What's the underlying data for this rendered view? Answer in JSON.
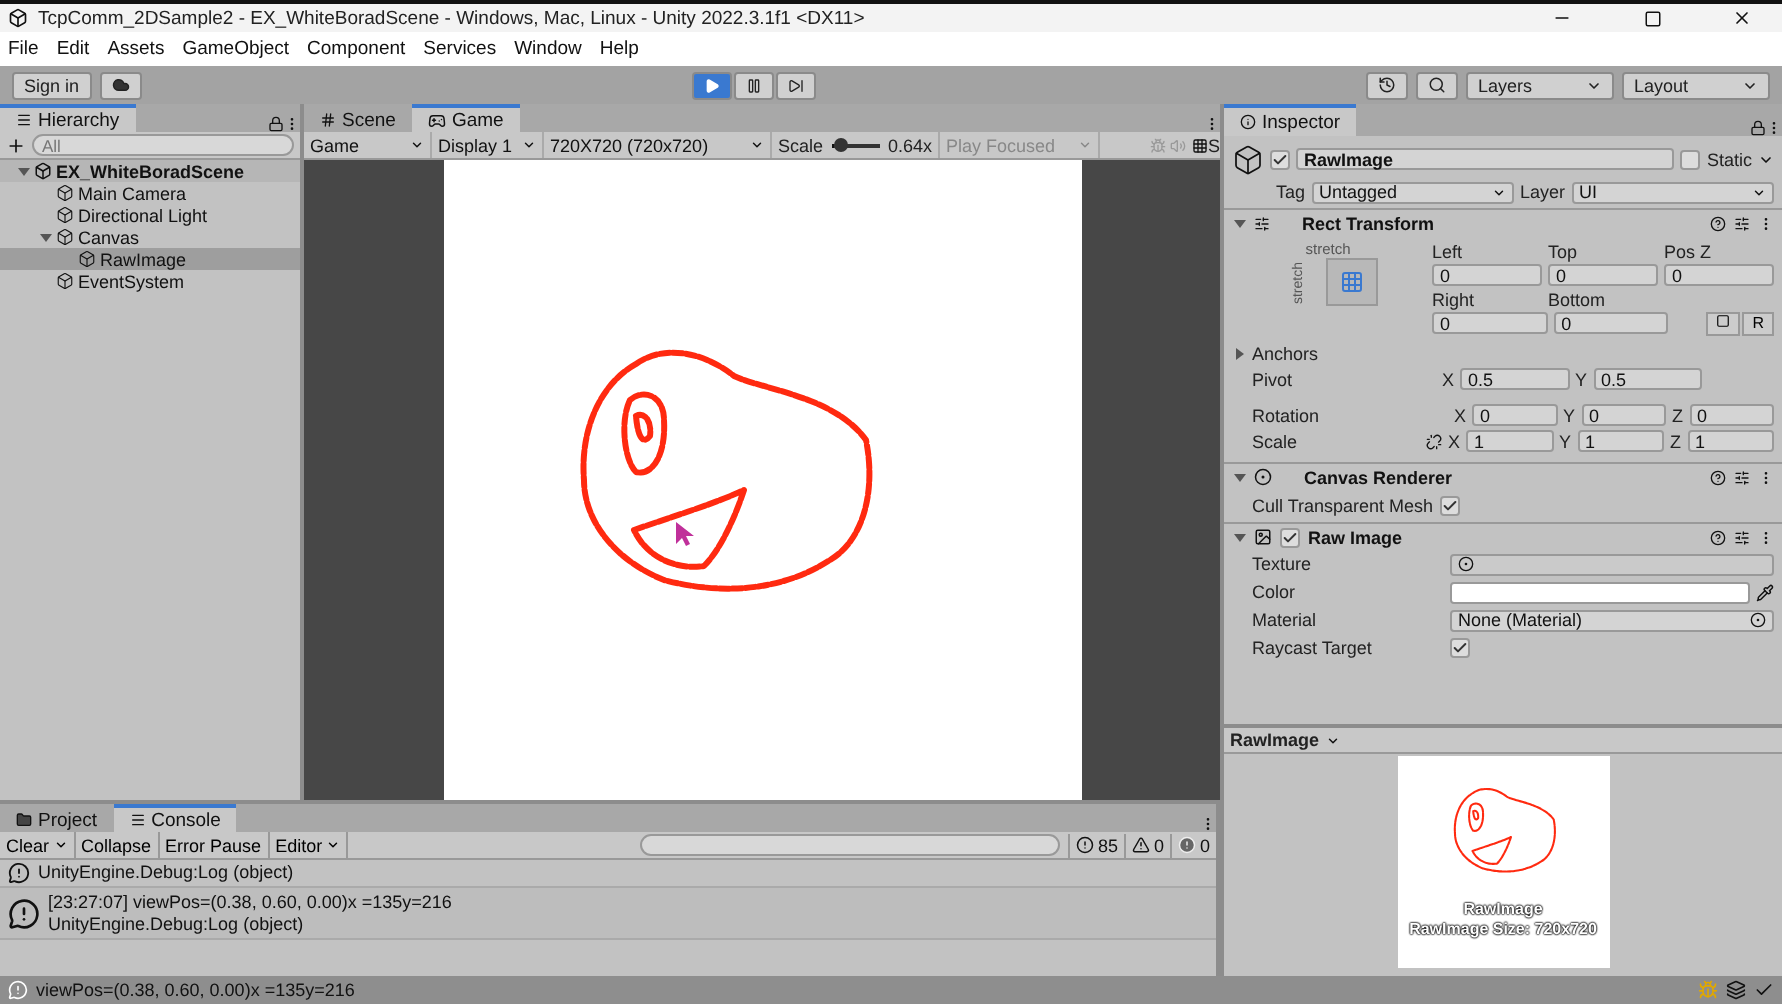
{
  "window": {
    "title": "TcpComm_2DSample2 - EX_WhiteBoradScene - Windows, Mac, Linux - Unity 2022.3.1f1 <DX11>"
  },
  "menu": [
    "File",
    "Edit",
    "Assets",
    "GameObject",
    "Component",
    "Services",
    "Window",
    "Help"
  ],
  "toolbar": {
    "sign_in": "Sign in",
    "playing": true,
    "layers": "Layers",
    "layout": "Layout"
  },
  "hierarchy": {
    "title": "Hierarchy",
    "search": {
      "placeholder": "All"
    },
    "items": [
      {
        "label": "EX_WhiteBoradScene",
        "kind": "scene",
        "expanded": true,
        "selected": false,
        "children": [
          {
            "label": "Main Camera",
            "kind": "object",
            "selected": false
          },
          {
            "label": "Directional Light",
            "kind": "object",
            "selected": false
          },
          {
            "label": "Canvas",
            "kind": "object",
            "expanded": true,
            "selected": false,
            "children": [
              {
                "label": "RawImage",
                "kind": "object",
                "selected": true
              }
            ]
          },
          {
            "label": "EventSystem",
            "kind": "object",
            "selected": false
          }
        ]
      }
    ]
  },
  "game": {
    "tabs": [
      {
        "label": "Scene",
        "selected": false
      },
      {
        "label": "Game",
        "selected": true
      }
    ],
    "view_dropdown": "Game",
    "display": "Display 1",
    "resolution": "720X720 (720x720)",
    "scale_label": "Scale",
    "scale": {
      "level": 0.05
    },
    "scale_value": "0.64x",
    "play_mode": "Play Focused",
    "stats": "S"
  },
  "inspector": {
    "title": "Inspector",
    "object": {
      "name": "RawImage",
      "active": true,
      "static_label": "Static",
      "static": false,
      "tag_label": "Tag",
      "tag": "Untagged",
      "layer_label": "Layer",
      "layer": "UI"
    },
    "rect_transform": {
      "title": "Rect Transform",
      "preset_top": "stretch",
      "preset_side": "stretch",
      "fields_row1": [
        {
          "label": "Left",
          "value": "0"
        },
        {
          "label": "Top",
          "value": "0"
        },
        {
          "label": "Pos Z",
          "value": "0"
        }
      ],
      "fields_row2": [
        {
          "label": "Right",
          "value": "0"
        },
        {
          "label": "Bottom",
          "value": "0"
        }
      ],
      "raw_button": "R",
      "anchors": "Anchors",
      "pivot": {
        "label": "Pivot",
        "axes": [
          {
            "axis": "X",
            "value": "0.5"
          },
          {
            "axis": "Y",
            "value": "0.5"
          }
        ]
      },
      "rotation": {
        "label": "Rotation",
        "axes": [
          {
            "axis": "X",
            "value": "0"
          },
          {
            "axis": "Y",
            "value": "0"
          },
          {
            "axis": "Z",
            "value": "0"
          }
        ]
      },
      "scale": {
        "label": "Scale",
        "axes": [
          {
            "axis": "X",
            "value": "1"
          },
          {
            "axis": "Y",
            "value": "1"
          },
          {
            "axis": "Z",
            "value": "1"
          }
        ]
      }
    },
    "canvas_renderer": {
      "title": "Canvas Renderer",
      "cull_label": "Cull Transparent Mesh",
      "cull": true
    },
    "raw_image": {
      "title": "Raw Image",
      "enabled": true,
      "rows": [
        {
          "label": "Texture",
          "kind": "object"
        },
        {
          "label": "Color",
          "kind": "color"
        },
        {
          "label": "Material",
          "kind": "object",
          "value": "None (Material)"
        },
        {
          "label": "Raycast Target",
          "kind": "checkbox",
          "checked": true
        }
      ]
    },
    "preview": {
      "title": "RawImage",
      "caption": "RawImage",
      "size": "RawImage Size: 720x720"
    }
  },
  "console": {
    "tabs": [
      {
        "label": "Project",
        "selected": false
      },
      {
        "label": "Console",
        "selected": true
      }
    ],
    "buttons": [
      "Clear",
      "Collapse",
      "Error Pause",
      "Editor"
    ],
    "counts": {
      "log": "85",
      "warning": "0",
      "error": "0"
    },
    "entries": [
      {
        "line2": "UnityEngine.Debug:Log (object)"
      },
      {
        "line1": "[23:27:07] viewPos=(0.38, 0.60, 0.00)x =135y=216",
        "line2": "UnityEngine.Debug:Log (object)"
      }
    ]
  },
  "status_bar": {
    "message": "viewPos=(0.38, 0.60, 0.00)x =135y=216"
  }
}
